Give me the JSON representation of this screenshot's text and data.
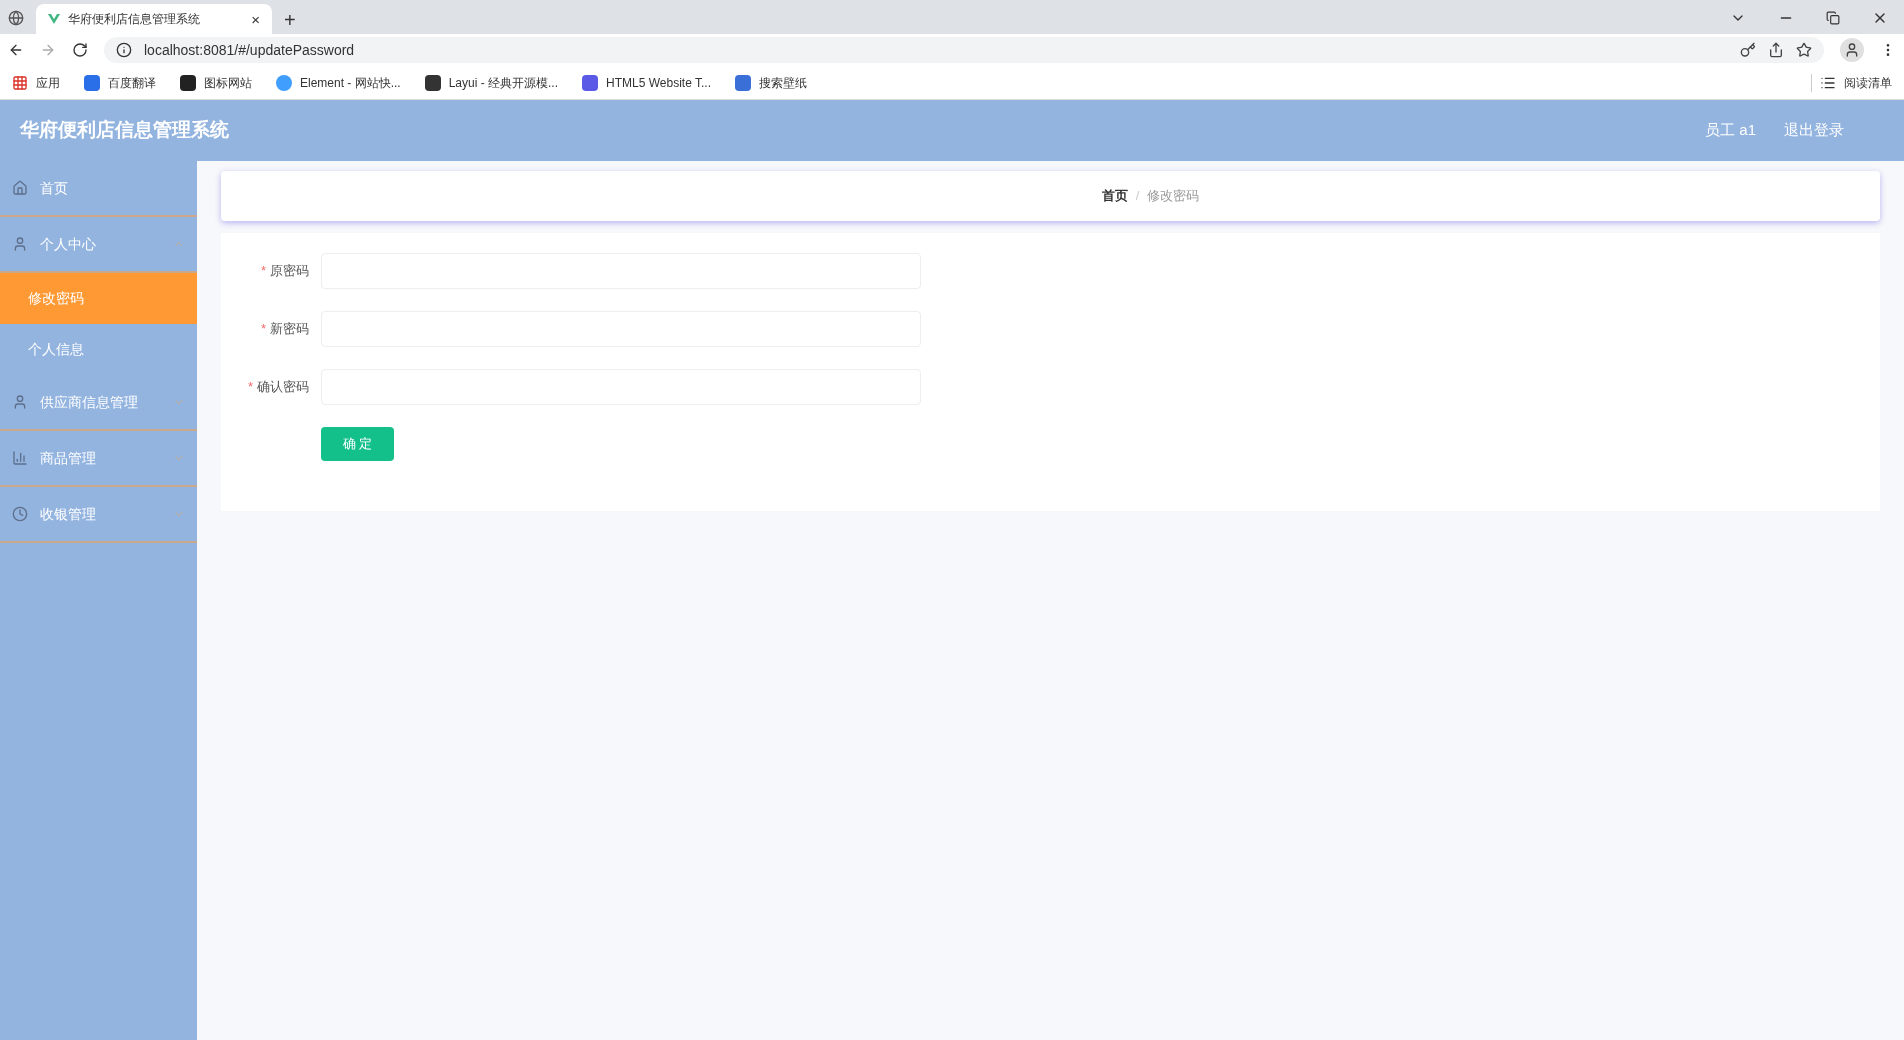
{
  "browser": {
    "tab_title": "华府便利店信息管理系统",
    "tab_close": "×",
    "new_tab": "+",
    "url": "localhost:8081/#/updatePassword",
    "bookmarks": [
      {
        "label": "应用",
        "kind": "apps"
      },
      {
        "label": "百度翻译",
        "kind": "translate"
      },
      {
        "label": "图标网站",
        "kind": "dark"
      },
      {
        "label": "Element - 网站快...",
        "kind": "element"
      },
      {
        "label": "Layui - 经典开源模...",
        "kind": "layui"
      },
      {
        "label": "HTML5 Website T...",
        "kind": "html5"
      },
      {
        "label": "搜索壁纸",
        "kind": "wallpaper"
      }
    ],
    "reading_list": "阅读清单"
  },
  "header": {
    "title": "华府便利店信息管理系统",
    "user": "员工 a1",
    "logout": "退出登录"
  },
  "sidebar": {
    "items": [
      {
        "label": "首页",
        "kind": "home",
        "selected": false
      },
      {
        "label": "个人中心",
        "kind": "user",
        "selected": false,
        "expanded": true,
        "children": [
          {
            "label": "修改密码",
            "selected": true
          },
          {
            "label": "个人信息",
            "selected": false
          }
        ]
      },
      {
        "label": "供应商信息管理",
        "kind": "user",
        "selected": false,
        "expanded": false
      },
      {
        "label": "商品管理",
        "kind": "chart",
        "selected": false,
        "expanded": false
      },
      {
        "label": "收银管理",
        "kind": "clock",
        "selected": false,
        "expanded": false
      }
    ]
  },
  "breadcrumb": {
    "separator": "/",
    "items": [
      {
        "label": "首页",
        "current": false
      },
      {
        "label": "修改密码",
        "current": true
      }
    ]
  },
  "form": {
    "fields": [
      {
        "label": "原密码",
        "mark": "*"
      },
      {
        "label": "新密码",
        "mark": "*"
      },
      {
        "label": "确认密码",
        "mark": "*"
      }
    ],
    "submit": "确 定"
  }
}
